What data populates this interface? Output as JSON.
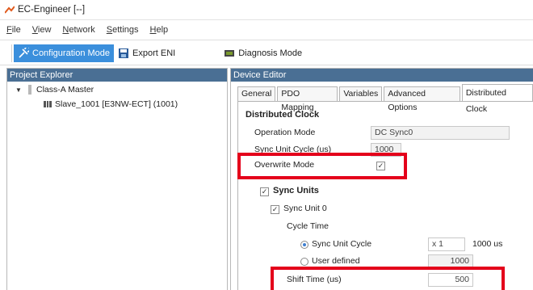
{
  "window": {
    "title": "EC-Engineer [--]"
  },
  "menu": {
    "items": [
      {
        "first": "F",
        "rest": "ile"
      },
      {
        "first": "V",
        "rest": "iew"
      },
      {
        "first": "N",
        "rest": "etwork"
      },
      {
        "first": "S",
        "rest": "ettings"
      },
      {
        "first": "H",
        "rest": "elp"
      }
    ]
  },
  "toolbar": {
    "configuration_mode": "Configuration Mode",
    "export_eni": "Export ENI",
    "diagnosis_mode": "Diagnosis Mode"
  },
  "project_explorer": {
    "header": "Project Explorer",
    "master": "Class-A Master",
    "slave": "Slave_1001 [E3NW-ECT] (1001)"
  },
  "device_editor": {
    "header": "Device Editor",
    "tabs": [
      "General",
      "PDO Mapping",
      "Variables",
      "Advanced Options",
      "Distributed Clock"
    ],
    "section_title": "Distributed Clock",
    "operation_mode_label": "Operation Mode",
    "operation_mode_value": "DC Sync0",
    "sync_unit_cycle_label": "Sync Unit Cycle (us)",
    "sync_unit_cycle_value": "1000",
    "overwrite_mode_label": "Overwrite Mode",
    "overwrite_mode_checked": true,
    "sync_units_label": "Sync Units",
    "sync_units_checked": true,
    "sync_unit_0_label": "Sync Unit 0",
    "sync_unit_0_checked": true,
    "cycle_time_label": "Cycle Time",
    "sync_unit_cycle_option": "Sync Unit Cycle",
    "multiplier_value": "x 1",
    "cycle_us_value": "1000 us",
    "user_defined_option": "User defined",
    "user_defined_value": "1000",
    "shift_time_label": "Shift Time (us)",
    "shift_time_value": "500",
    "check_mark": "✓"
  },
  "colors": {
    "pane_header": "#4a6f94",
    "active_button": "#3b8fdc",
    "highlight": "#e4001b"
  }
}
